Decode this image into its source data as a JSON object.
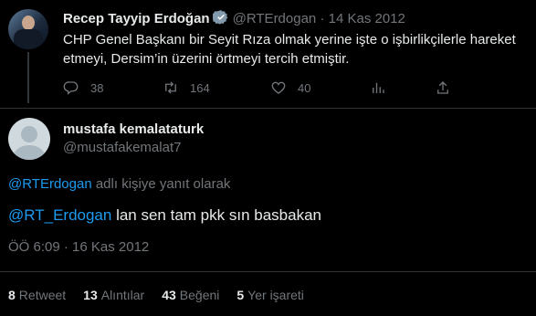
{
  "parent": {
    "name": "Recep Tayyip Erdoğan",
    "handle": "@RTErdogan",
    "separator": "·",
    "date": "14 Kas 2012",
    "text": "CHP Genel Başkanı bir Seyit Rıza olmak yerine işte o işbirlikçilerle hareket etmeyi, Dersim’in üzerini örtmeyi tercih etmiştir.",
    "actions": {
      "reply_count": "38",
      "retweet_count": "164",
      "like_count": "40"
    },
    "icons": [
      "reply-icon",
      "retweet-icon",
      "like-icon",
      "views-icon",
      "share-icon"
    ]
  },
  "reply": {
    "name": "mustafa kemalataturk",
    "handle": "@mustafakemalat7",
    "replying_mention": "@RTErdogan",
    "replying_suffix": "adlı kişiye yanıt olarak",
    "text_mention": "@RT_Erdogan",
    "text_rest": " lan sen tam pkk sın basbakan",
    "timestamp": "ÖÖ 6:09 · 16 Kas 2012"
  },
  "stats": {
    "retweets_count": "8",
    "retweets_label": "Retweet",
    "quotes_count": "13",
    "quotes_label": "Alıntılar",
    "likes_count": "43",
    "likes_label": "Beğeni",
    "bookmarks_count": "5",
    "bookmarks_label": "Yer işareti"
  },
  "colors": {
    "background": "#000000",
    "text": "#e7e9ea",
    "muted": "#71767b",
    "link": "#1d9bf0",
    "divider": "#2f3336"
  }
}
